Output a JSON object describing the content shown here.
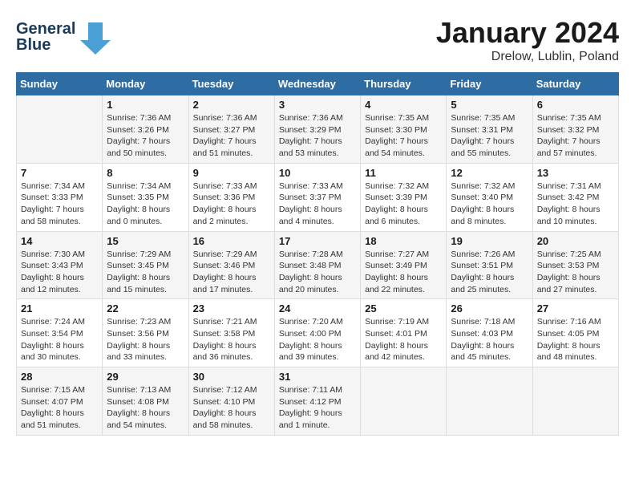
{
  "logo": {
    "line1": "General",
    "line2": "Blue",
    "arrow": true
  },
  "title": "January 2024",
  "location": "Drelow, Lublin, Poland",
  "columns": [
    "Sunday",
    "Monday",
    "Tuesday",
    "Wednesday",
    "Thursday",
    "Friday",
    "Saturday"
  ],
  "weeks": [
    [
      {
        "day": "",
        "sunrise": "",
        "sunset": "",
        "daylight": ""
      },
      {
        "day": "1",
        "sunrise": "Sunrise: 7:36 AM",
        "sunset": "Sunset: 3:26 PM",
        "daylight": "Daylight: 7 hours and 50 minutes."
      },
      {
        "day": "2",
        "sunrise": "Sunrise: 7:36 AM",
        "sunset": "Sunset: 3:27 PM",
        "daylight": "Daylight: 7 hours and 51 minutes."
      },
      {
        "day": "3",
        "sunrise": "Sunrise: 7:36 AM",
        "sunset": "Sunset: 3:29 PM",
        "daylight": "Daylight: 7 hours and 53 minutes."
      },
      {
        "day": "4",
        "sunrise": "Sunrise: 7:35 AM",
        "sunset": "Sunset: 3:30 PM",
        "daylight": "Daylight: 7 hours and 54 minutes."
      },
      {
        "day": "5",
        "sunrise": "Sunrise: 7:35 AM",
        "sunset": "Sunset: 3:31 PM",
        "daylight": "Daylight: 7 hours and 55 minutes."
      },
      {
        "day": "6",
        "sunrise": "Sunrise: 7:35 AM",
        "sunset": "Sunset: 3:32 PM",
        "daylight": "Daylight: 7 hours and 57 minutes."
      }
    ],
    [
      {
        "day": "7",
        "sunrise": "Sunrise: 7:34 AM",
        "sunset": "Sunset: 3:33 PM",
        "daylight": "Daylight: 7 hours and 58 minutes."
      },
      {
        "day": "8",
        "sunrise": "Sunrise: 7:34 AM",
        "sunset": "Sunset: 3:35 PM",
        "daylight": "Daylight: 8 hours and 0 minutes."
      },
      {
        "day": "9",
        "sunrise": "Sunrise: 7:33 AM",
        "sunset": "Sunset: 3:36 PM",
        "daylight": "Daylight: 8 hours and 2 minutes."
      },
      {
        "day": "10",
        "sunrise": "Sunrise: 7:33 AM",
        "sunset": "Sunset: 3:37 PM",
        "daylight": "Daylight: 8 hours and 4 minutes."
      },
      {
        "day": "11",
        "sunrise": "Sunrise: 7:32 AM",
        "sunset": "Sunset: 3:39 PM",
        "daylight": "Daylight: 8 hours and 6 minutes."
      },
      {
        "day": "12",
        "sunrise": "Sunrise: 7:32 AM",
        "sunset": "Sunset: 3:40 PM",
        "daylight": "Daylight: 8 hours and 8 minutes."
      },
      {
        "day": "13",
        "sunrise": "Sunrise: 7:31 AM",
        "sunset": "Sunset: 3:42 PM",
        "daylight": "Daylight: 8 hours and 10 minutes."
      }
    ],
    [
      {
        "day": "14",
        "sunrise": "Sunrise: 7:30 AM",
        "sunset": "Sunset: 3:43 PM",
        "daylight": "Daylight: 8 hours and 12 minutes."
      },
      {
        "day": "15",
        "sunrise": "Sunrise: 7:29 AM",
        "sunset": "Sunset: 3:45 PM",
        "daylight": "Daylight: 8 hours and 15 minutes."
      },
      {
        "day": "16",
        "sunrise": "Sunrise: 7:29 AM",
        "sunset": "Sunset: 3:46 PM",
        "daylight": "Daylight: 8 hours and 17 minutes."
      },
      {
        "day": "17",
        "sunrise": "Sunrise: 7:28 AM",
        "sunset": "Sunset: 3:48 PM",
        "daylight": "Daylight: 8 hours and 20 minutes."
      },
      {
        "day": "18",
        "sunrise": "Sunrise: 7:27 AM",
        "sunset": "Sunset: 3:49 PM",
        "daylight": "Daylight: 8 hours and 22 minutes."
      },
      {
        "day": "19",
        "sunrise": "Sunrise: 7:26 AM",
        "sunset": "Sunset: 3:51 PM",
        "daylight": "Daylight: 8 hours and 25 minutes."
      },
      {
        "day": "20",
        "sunrise": "Sunrise: 7:25 AM",
        "sunset": "Sunset: 3:53 PM",
        "daylight": "Daylight: 8 hours and 27 minutes."
      }
    ],
    [
      {
        "day": "21",
        "sunrise": "Sunrise: 7:24 AM",
        "sunset": "Sunset: 3:54 PM",
        "daylight": "Daylight: 8 hours and 30 minutes."
      },
      {
        "day": "22",
        "sunrise": "Sunrise: 7:23 AM",
        "sunset": "Sunset: 3:56 PM",
        "daylight": "Daylight: 8 hours and 33 minutes."
      },
      {
        "day": "23",
        "sunrise": "Sunrise: 7:21 AM",
        "sunset": "Sunset: 3:58 PM",
        "daylight": "Daylight: 8 hours and 36 minutes."
      },
      {
        "day": "24",
        "sunrise": "Sunrise: 7:20 AM",
        "sunset": "Sunset: 4:00 PM",
        "daylight": "Daylight: 8 hours and 39 minutes."
      },
      {
        "day": "25",
        "sunrise": "Sunrise: 7:19 AM",
        "sunset": "Sunset: 4:01 PM",
        "daylight": "Daylight: 8 hours and 42 minutes."
      },
      {
        "day": "26",
        "sunrise": "Sunrise: 7:18 AM",
        "sunset": "Sunset: 4:03 PM",
        "daylight": "Daylight: 8 hours and 45 minutes."
      },
      {
        "day": "27",
        "sunrise": "Sunrise: 7:16 AM",
        "sunset": "Sunset: 4:05 PM",
        "daylight": "Daylight: 8 hours and 48 minutes."
      }
    ],
    [
      {
        "day": "28",
        "sunrise": "Sunrise: 7:15 AM",
        "sunset": "Sunset: 4:07 PM",
        "daylight": "Daylight: 8 hours and 51 minutes."
      },
      {
        "day": "29",
        "sunrise": "Sunrise: 7:13 AM",
        "sunset": "Sunset: 4:08 PM",
        "daylight": "Daylight: 8 hours and 54 minutes."
      },
      {
        "day": "30",
        "sunrise": "Sunrise: 7:12 AM",
        "sunset": "Sunset: 4:10 PM",
        "daylight": "Daylight: 8 hours and 58 minutes."
      },
      {
        "day": "31",
        "sunrise": "Sunrise: 7:11 AM",
        "sunset": "Sunset: 4:12 PM",
        "daylight": "Daylight: 9 hours and 1 minute."
      },
      {
        "day": "",
        "sunrise": "",
        "sunset": "",
        "daylight": ""
      },
      {
        "day": "",
        "sunrise": "",
        "sunset": "",
        "daylight": ""
      },
      {
        "day": "",
        "sunrise": "",
        "sunset": "",
        "daylight": ""
      }
    ]
  ]
}
